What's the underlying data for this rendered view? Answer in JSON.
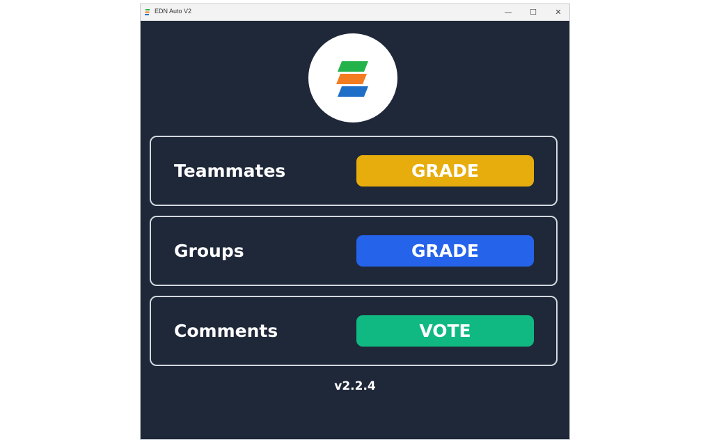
{
  "window": {
    "title": "EDN Auto V2",
    "minimize_glyph": "—",
    "maximize_glyph": "☐",
    "close_glyph": "✕"
  },
  "logo": {
    "colors": [
      "#24b24b",
      "#f47c20",
      "#1f6fc9"
    ]
  },
  "rows": [
    {
      "label": "Teammates",
      "button": "GRADE",
      "button_color": "#e7ad0d"
    },
    {
      "label": "Groups",
      "button": "GRADE",
      "button_color": "#2563eb"
    },
    {
      "label": "Comments",
      "button": "VOTE",
      "button_color": "#10b981"
    }
  ],
  "version": "v2.2.4",
  "theme": {
    "background": "#1f2839",
    "border": "#d4d8df"
  }
}
